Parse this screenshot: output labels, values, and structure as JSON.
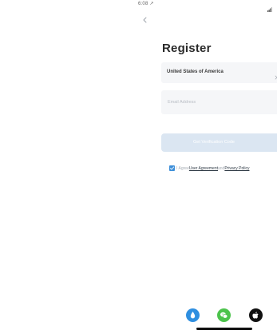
{
  "status_bar": {
    "time": "6:08 ↗",
    "signal_icon": "signal-icon"
  },
  "header": {
    "back_icon": "chevron-left-icon",
    "title": "Register"
  },
  "form": {
    "country": {
      "value": "United States of America",
      "icon": "chevron-right-icon"
    },
    "email": {
      "value": "",
      "placeholder": "Email Address"
    },
    "verify_button_label": "Get Verification Code",
    "agreement": {
      "checked": true,
      "prefix": "I Agree",
      "user_agreement": "User Agreement",
      "conjunction": "and",
      "privacy_policy": "Privacy Policy"
    }
  },
  "social_login": [
    {
      "name": "social-login-blue",
      "icon": "drop-icon",
      "color": "#2f8fe0"
    },
    {
      "name": "social-login-wechat",
      "icon": "wechat-icon",
      "color": "#4cc34c"
    },
    {
      "name": "social-login-apple",
      "icon": "apple-icon",
      "color": "#111111"
    }
  ],
  "colors": {
    "accent": "#3d8fd9",
    "button_disabled": "#dbe6f2",
    "field_bg": "#f5f6f8"
  }
}
